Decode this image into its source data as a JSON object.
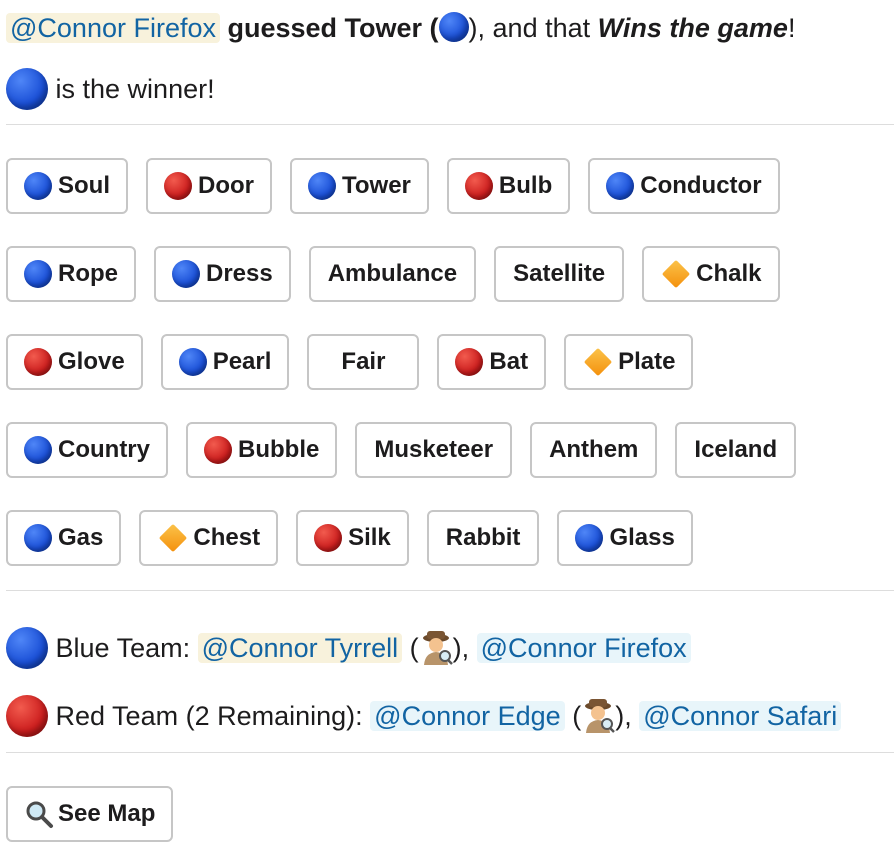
{
  "announcement": {
    "user": "@Connor Firefox",
    "guessed_text": "guessed Tower (",
    "after_text": "), and that",
    "emphasis": "Wins the game",
    "end": "!"
  },
  "winner_line": {
    "text": "is the winner!"
  },
  "board": {
    "rows": [
      [
        {
          "label": "Soul",
          "marker": "blue"
        },
        {
          "label": "Door",
          "marker": "red"
        },
        {
          "label": "Tower",
          "marker": "blue"
        },
        {
          "label": "Bulb",
          "marker": "red"
        },
        {
          "label": "Conductor",
          "marker": "blue"
        }
      ],
      [
        {
          "label": "Rope",
          "marker": "blue"
        },
        {
          "label": "Dress",
          "marker": "blue"
        },
        {
          "label": "Ambulance",
          "marker": "none"
        },
        {
          "label": "Satellite",
          "marker": "none"
        },
        {
          "label": "Chalk",
          "marker": "orange-diamond"
        }
      ],
      [
        {
          "label": "Glove",
          "marker": "red"
        },
        {
          "label": "Pearl",
          "marker": "blue"
        },
        {
          "label": "Fair",
          "marker": "none"
        },
        {
          "label": "Bat",
          "marker": "red"
        },
        {
          "label": "Plate",
          "marker": "orange-diamond"
        }
      ],
      [
        {
          "label": "Country",
          "marker": "blue"
        },
        {
          "label": "Bubble",
          "marker": "red"
        },
        {
          "label": "Musketeer",
          "marker": "none"
        },
        {
          "label": "Anthem",
          "marker": "none"
        },
        {
          "label": "Iceland",
          "marker": "none"
        }
      ],
      [
        {
          "label": "Gas",
          "marker": "blue"
        },
        {
          "label": "Chest",
          "marker": "orange-diamond"
        },
        {
          "label": "Silk",
          "marker": "red"
        },
        {
          "label": "Rabbit",
          "marker": "none"
        },
        {
          "label": "Glass",
          "marker": "blue"
        }
      ]
    ]
  },
  "teams": {
    "blue": {
      "label": "Blue Team:",
      "spymaster": "@Connor Tyrrell",
      "member": "@Connor Firefox"
    },
    "red": {
      "label": "Red Team (2 Remaining):",
      "spymaster": "@Connor Edge",
      "member": "@Connor Safari"
    }
  },
  "punct": {
    "open": "(",
    "close_comma": "),"
  },
  "actions": {
    "see_map": "See Map"
  },
  "colors": {
    "mention_bg": "#e8f5fa",
    "mention_self_bg": "#f8f2dc",
    "mention_text": "#1264a3",
    "blue": "#1a4fd6",
    "red": "#cc1e1e",
    "neutral_marker": "#f4900c",
    "button_border": "#c6c6c6"
  }
}
